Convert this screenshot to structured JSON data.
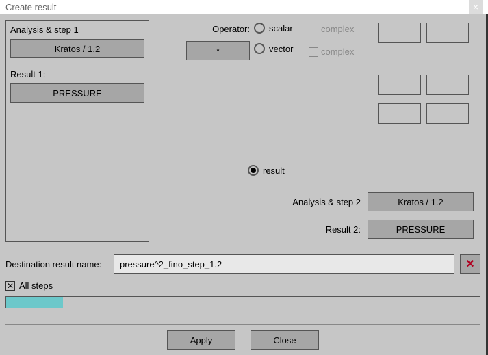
{
  "window": {
    "title": "Create result",
    "close": "×"
  },
  "left": {
    "analysis_step_label": "Analysis & step 1",
    "analysis_btn": "Kratos / 1.2",
    "result_label": "Result 1:",
    "result_btn": "PRESSURE"
  },
  "operator": {
    "label": "Operator:",
    "btn": "*"
  },
  "radios": {
    "scalar": "scalar",
    "vector": "vector",
    "result": "result"
  },
  "complex": {
    "label": "complex"
  },
  "as2": {
    "label": "Analysis & step 2",
    "btn": "Kratos / 1.2"
  },
  "r2": {
    "label": "Result 2:",
    "btn": "PRESSURE"
  },
  "dest": {
    "label": "Destination result name:",
    "value": "pressure^2_fino_step_1.2",
    "red_x": "✕"
  },
  "allsteps": {
    "check": "✕",
    "label": "All steps"
  },
  "buttons": {
    "apply": "Apply",
    "close": "Close"
  }
}
